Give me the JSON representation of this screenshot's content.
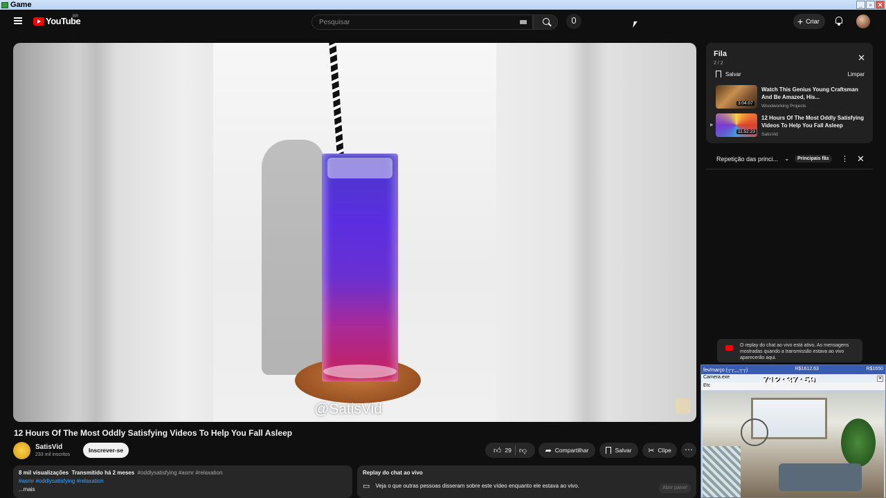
{
  "os": {
    "window_title": "Game",
    "buttons": [
      "_",
      "▫",
      "✕"
    ]
  },
  "header": {
    "logo_text": "YouTube",
    "country_code": "BR",
    "search_placeholder": "Pesquisar",
    "create_label": "Criar",
    "icons": [
      "menu-icon",
      "search-icon",
      "keyboard-icon",
      "mic-icon",
      "plus-icon",
      "bell-icon",
      "avatar"
    ]
  },
  "player": {
    "watermark": "@SatisVid"
  },
  "video": {
    "title": "12 Hours Of The Most Oddly Satisfying Videos To Help You Fall Asleep",
    "channel_name": "SatisVid",
    "subscribers": "233 mil inscritos",
    "subscribe_label": "Inscrever-se",
    "like_count": "29",
    "share_label": "Compartilhar",
    "save_label": "Salvar",
    "clip_label": "Clipe"
  },
  "description": {
    "views": "8 mil visualizações",
    "streamed": "Transmitido há 2 meses",
    "tags_line1": "#oddlysatisfying #asmr #relaxation",
    "tags_line2": "#asmr #oddlysatisfying #relaxation",
    "more_label": "...mais"
  },
  "chat_replay_box": {
    "title": "Replay do chat ao vivo",
    "text": "Veja o que outras pessoas disseram sobre este vídeo enquanto ele estava ao vivo.",
    "open_label": "Abrir painel"
  },
  "queue": {
    "title": "Fila",
    "count": "2 / 2",
    "save_label": "Salvar",
    "clear_label": "Limpar",
    "items": [
      {
        "title": "Watch This Genius Young Craftsman And Be Amazed, His...",
        "channel": "Woodworking Projects",
        "duration": "3:04:07"
      },
      {
        "title": "12 Hours Of The Most Oddly Satisfying Videos To Help You Fall Asleep",
        "channel": "SatisVid",
        "duration": "11:52:23"
      }
    ]
  },
  "live_chat": {
    "mode_label": "Repetição das princi...",
    "top_fans_label": "Principais fãs",
    "note": "O replay do chat ao vivo está ativo. As mensagens mostradas quando a transmissão estava ao vivo aparecerão aqui."
  },
  "camera_overlay": {
    "topbar_left": "fev/março (┬┬﹏┬┬)",
    "topbar_mid": "R$1612.63",
    "topbar_right": "R$1650",
    "window_title": "Camera.exe",
    "timer": "712:37:59",
    "menu": "Etc"
  }
}
